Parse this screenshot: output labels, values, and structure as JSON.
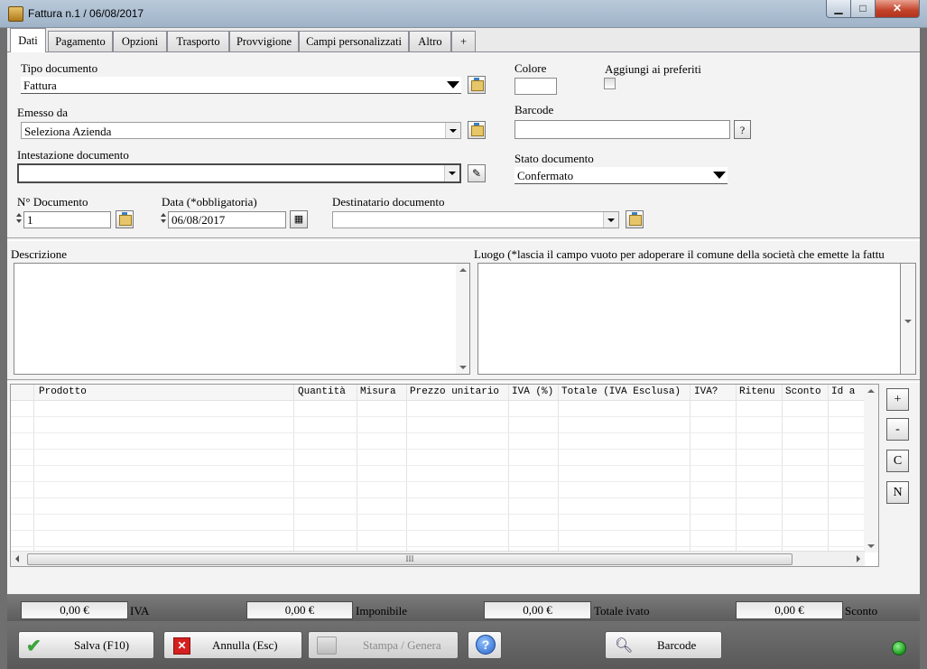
{
  "window": {
    "title": "Fattura n.1 / 06/08/2017"
  },
  "tabs": [
    "Dati",
    "Pagamento",
    "Opzioni",
    "Trasporto",
    "Provvigione",
    "Campi personalizzati",
    "Altro",
    "+"
  ],
  "form": {
    "tipo_documento": {
      "label": "Tipo documento",
      "value": "Fattura"
    },
    "colore": {
      "label": "Colore",
      "value": ""
    },
    "aggiungi_preferiti": {
      "label": "Aggiungi ai preferiti",
      "checked": false
    },
    "emesso_da": {
      "label": "Emesso da",
      "value": "Seleziona Azienda"
    },
    "barcode": {
      "label": "Barcode",
      "value": "",
      "help": "?"
    },
    "intestazione": {
      "label": "Intestazione documento",
      "value": ""
    },
    "stato_documento": {
      "label": "Stato documento",
      "value": "Confermato"
    },
    "n_documento": {
      "label": "N° Documento",
      "value": "1"
    },
    "data": {
      "label": "Data (*obbligatoria)",
      "value": "06/08/2017"
    },
    "destinatario": {
      "label": "Destinatario documento",
      "value": ""
    },
    "descrizione": {
      "label": "Descrizione",
      "value": ""
    },
    "luogo": {
      "label": "Luogo (*lascia il campo vuoto per adoperare il comune della società che emette la fattu",
      "value": ""
    }
  },
  "grid": {
    "columns": [
      "Prodotto",
      "Quantità",
      "Misura",
      "Prezzo unitario",
      "IVA (%)",
      "Totale (IVA Esclusa)",
      "IVA?",
      "Ritenu",
      "Sconto",
      "Id a"
    ],
    "rows": [],
    "scroll_thumb": "III"
  },
  "side_buttons": [
    "+",
    "-",
    "C",
    "N"
  ],
  "totals": {
    "iva": {
      "value": "0,00 €",
      "label": "IVA"
    },
    "imponibile": {
      "value": "0,00 €",
      "label": "Imponibile"
    },
    "totale_ivato": {
      "value": "0,00 €",
      "label": "Totale ivato"
    },
    "sconto": {
      "value": "0,00 €",
      "label": "Sconto"
    }
  },
  "actions": {
    "salva": "Salva  (F10)",
    "annulla": "Annulla  (Esc)",
    "stampa": "Stampa / Genera",
    "barcode": "Barcode"
  },
  "colors": {
    "accent_close": "#c3432a",
    "status_led": "#1c9a1c",
    "salva_check": "#3aa33a",
    "annulla_x": "#d42020"
  }
}
